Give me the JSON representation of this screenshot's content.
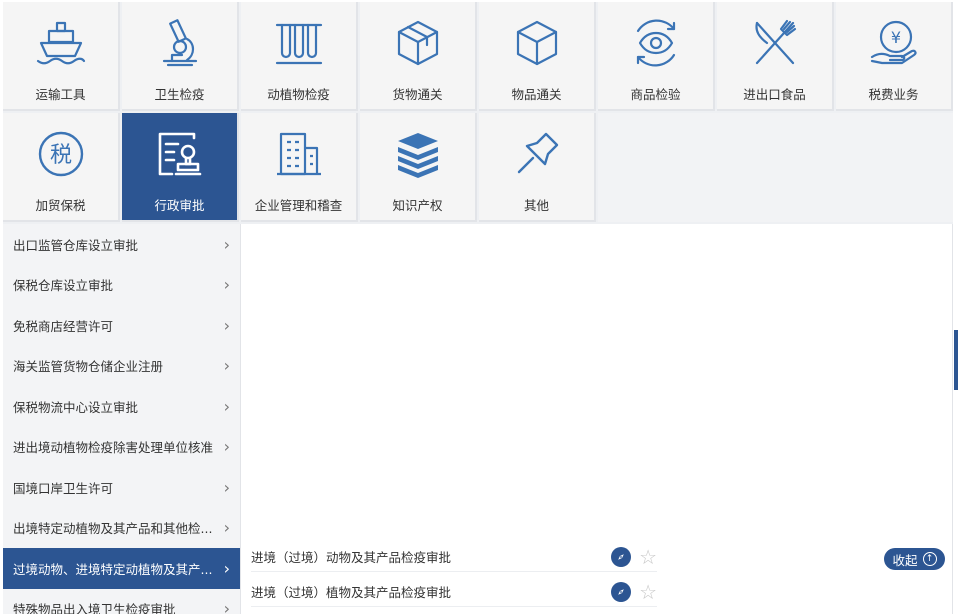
{
  "categories": [
    {
      "label": "运输工具",
      "icon": "ship-icon"
    },
    {
      "label": "卫生检疫",
      "icon": "microscope-icon"
    },
    {
      "label": "动植物检疫",
      "icon": "test-tubes-icon"
    },
    {
      "label": "货物通关",
      "icon": "cargo-box-icon"
    },
    {
      "label": "物品通关",
      "icon": "cube-icon"
    },
    {
      "label": "商品检验",
      "icon": "eye-inspect-icon"
    },
    {
      "label": "进出口食品",
      "icon": "fork-knife-icon"
    },
    {
      "label": "税费业务",
      "icon": "yen-hand-icon"
    },
    {
      "label": "加贸保税",
      "icon": "tax-circle-icon"
    },
    {
      "label": "行政审批",
      "icon": "approval-stamp-icon"
    },
    {
      "label": "企业管理和稽查",
      "icon": "building-icon"
    },
    {
      "label": "知识产权",
      "icon": "books-icon"
    },
    {
      "label": "其他",
      "icon": "pushpin-icon"
    }
  ],
  "tax_glyph": "税",
  "yen_glyph": "¥",
  "active_category": "行政审批",
  "sidebar": {
    "items": [
      {
        "label": "出口监管仓库设立审批"
      },
      {
        "label": "保税仓库设立审批"
      },
      {
        "label": "免税商店经营许可"
      },
      {
        "label": "海关监管货物仓储企业注册"
      },
      {
        "label": "保税物流中心设立审批"
      },
      {
        "label": "进出境动植物检疫除害处理单位核准"
      },
      {
        "label": "国境口岸卫生许可"
      },
      {
        "label": "出境特定动植物及其产品和其他检..."
      },
      {
        "label": "过境动物、进境特定动植物及其产..."
      },
      {
        "label": "特殊物品出入境卫生检疫审批"
      }
    ],
    "chevron": "›",
    "active_index": 8
  },
  "content": {
    "rows": [
      {
        "label": "进境（过境）动物及其产品检疫审批"
      },
      {
        "label": "进境（过境）植物及其产品检疫审批"
      }
    ],
    "star_glyph": "☆"
  },
  "collapse": {
    "label": "收起",
    "arrow": "↑"
  },
  "colors": {
    "accent": "#2c5592",
    "icon": "#3b74b5",
    "tile_bg": "#f5f5f5"
  }
}
